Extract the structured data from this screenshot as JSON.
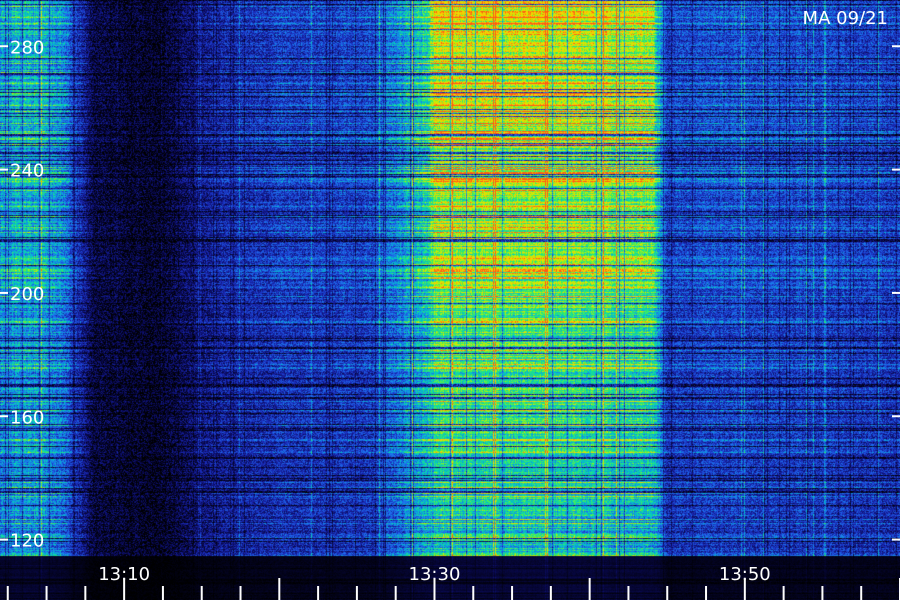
{
  "chart_data": {
    "type": "heatmap",
    "title": "MA 09/21",
    "xlabel": "",
    "ylabel": "",
    "x_tick_labels": [
      "13:10",
      "13:30",
      "13:50"
    ],
    "x_tick_values_min": [
      10,
      30,
      50
    ],
    "x_range_min": [
      2,
      60
    ],
    "y_tick_labels": [
      "120",
      "160",
      "200",
      "240",
      "280"
    ],
    "y_tick_values": [
      120,
      160,
      200,
      240,
      280
    ],
    "y_range": [
      115,
      295
    ],
    "colormap": [
      "#000000",
      "#0a0a5a",
      "#1a2ab8",
      "#1e6ef0",
      "#00c8c8",
      "#33ee66",
      "#c8f000",
      "#ffd000",
      "#ff5a14"
    ],
    "activity_profile": [
      {
        "t": 2,
        "level": 0.45
      },
      {
        "t": 4,
        "level": 0.5
      },
      {
        "t": 6,
        "level": 0.42
      },
      {
        "t": 8,
        "level": 0.1
      },
      {
        "t": 12,
        "level": 0.05
      },
      {
        "t": 16,
        "level": 0.22
      },
      {
        "t": 20,
        "level": 0.28
      },
      {
        "t": 26,
        "level": 0.3
      },
      {
        "t": 27.5,
        "level": 0.4
      },
      {
        "t": 29.5,
        "level": 0.55
      },
      {
        "t": 30,
        "level": 0.72
      },
      {
        "t": 36,
        "level": 0.7
      },
      {
        "t": 44,
        "level": 0.66
      },
      {
        "t": 45,
        "level": 0.28
      },
      {
        "t": 48,
        "level": 0.32
      },
      {
        "t": 54,
        "level": 0.3
      },
      {
        "t": 60,
        "level": 0.28
      }
    ]
  }
}
